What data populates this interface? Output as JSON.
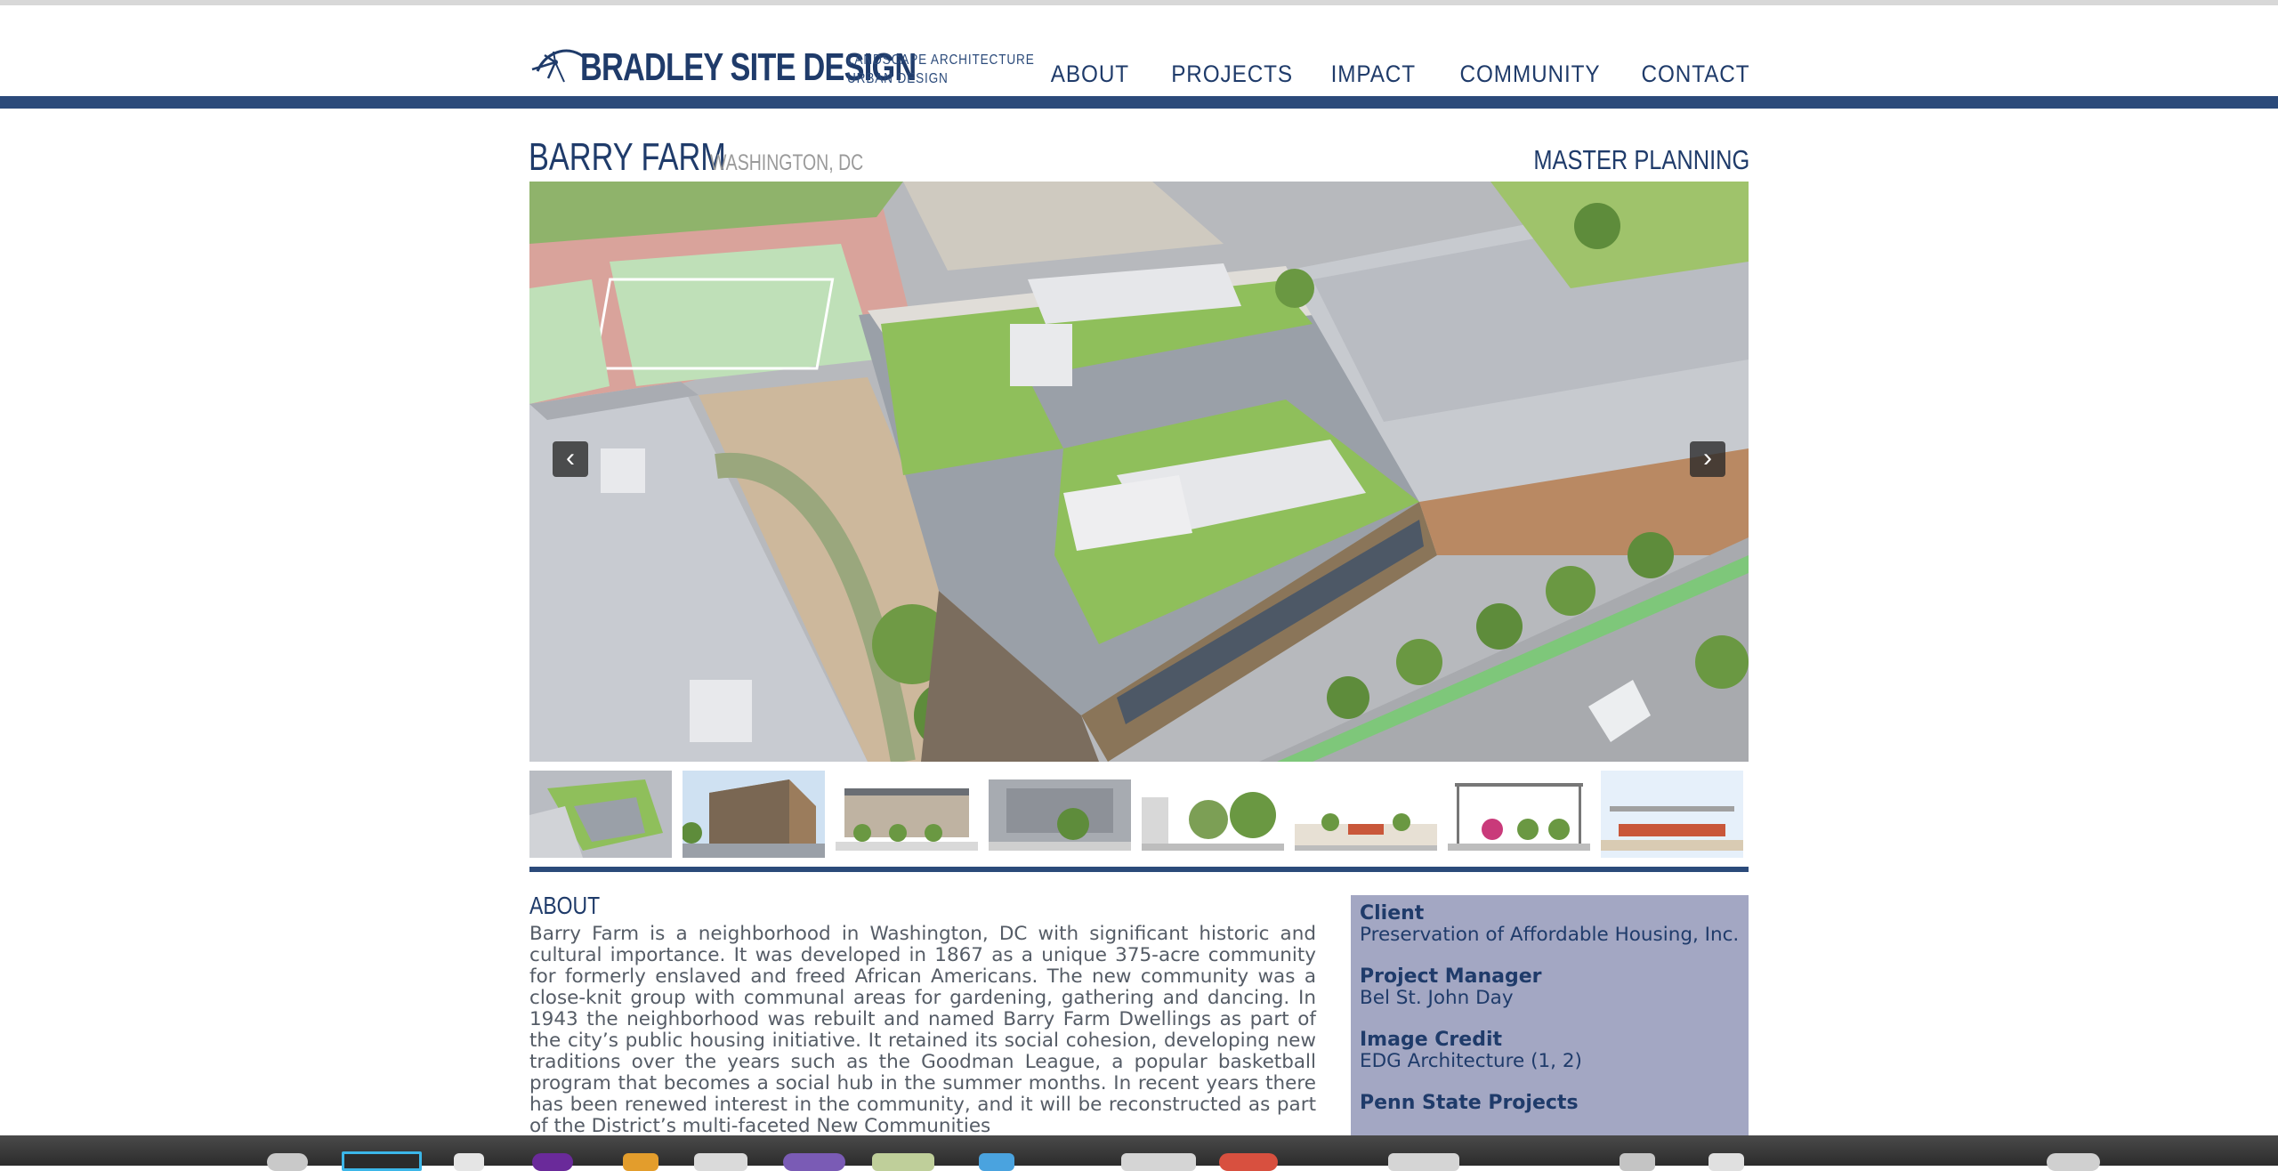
{
  "site": {
    "logo_name": "BRADLEY SITE DESIGN",
    "tagline_1": "LANDSCAPE ARCHITECTURE",
    "tagline_2": "URBAN DESIGN"
  },
  "nav": {
    "items": [
      "ABOUT",
      "PROJECTS",
      "IMPACT",
      "COMMUNITY",
      "CONTACT"
    ]
  },
  "project": {
    "name": "BARRY FARM",
    "location": "WASHINGTON, DC",
    "category": "MASTER PLANNING"
  },
  "slideshow": {
    "prev_glyph": "‹",
    "next_glyph": "›",
    "thumbnail_count": 8
  },
  "about": {
    "heading": "ABOUT",
    "body": "Barry Farm is a neighborhood in Washington, DC with significant historic and cultural importance. It was developed in 1867 as a unique 375-acre community for formerly enslaved and freed African Americans. The new community was a close-knit group with communal areas for gardening, gathering and dancing. In 1943 the neighborhood was rebuilt and named Barry Farm Dwellings as part of the city’s public housing initiative. It retained its social cohesion, developing new traditions over the years such as the Goodman League, a popular basketball program that becomes a social hub in the summer months. In recent years there has been renewed interest in the community, and it will be reconstructed as part of the District’s multi-faceted New Communities"
  },
  "info": {
    "client_label": "Client",
    "client_value": "Preservation of Affordable Housing, Inc.",
    "pm_label": "Project Manager",
    "pm_value": "Bel St. John Day",
    "credit_label": "Image Credit",
    "credit_value": "EDG Architecture (1, 2)",
    "psu_label": "Penn State Projects"
  },
  "colors": {
    "brand_navy": "#1f3b6a",
    "bar_blue": "#2b4a7a",
    "info_panel": "#a3a7c3",
    "body_text": "#555c66"
  }
}
